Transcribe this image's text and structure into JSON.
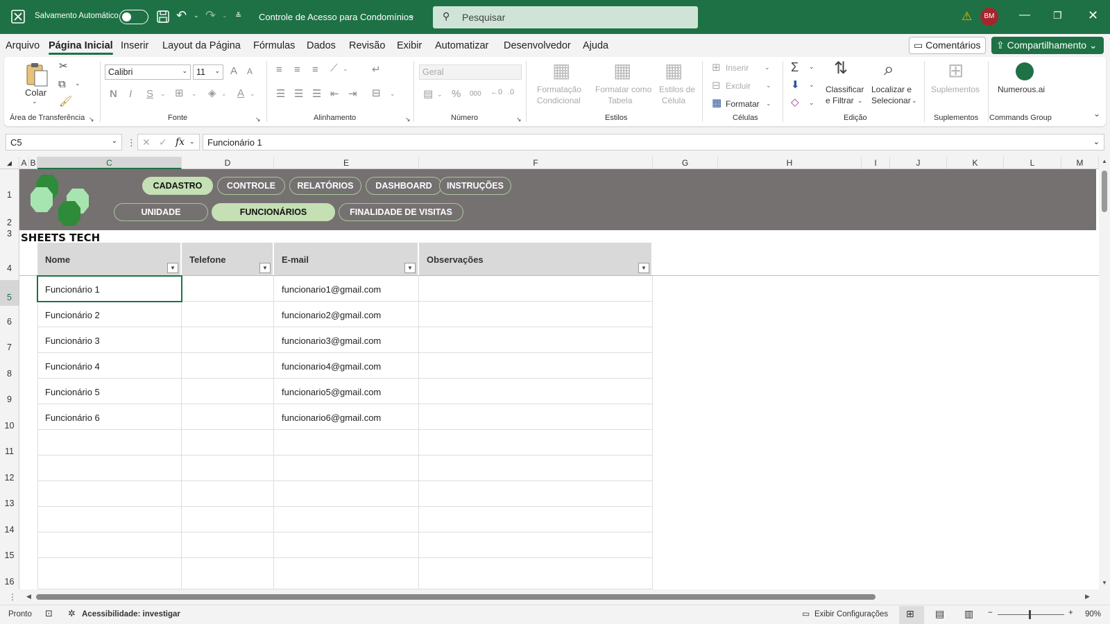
{
  "titlebar": {
    "autosave_label": "Salvamento Automático",
    "doc_title": "Controle de Acesso para Condomínios",
    "search_placeholder": "Pesquisar",
    "avatar_initials": "BM"
  },
  "menu": {
    "tabs": [
      "Arquivo",
      "Página Inicial",
      "Inserir",
      "Layout da Página",
      "Fórmulas",
      "Dados",
      "Revisão",
      "Exibir",
      "Automatizar",
      "Desenvolvedor",
      "Ajuda"
    ],
    "active_index": 1,
    "comments_label": "Comentários",
    "share_label": "Compartilhamento"
  },
  "ribbon": {
    "clipboard": {
      "paste_label": "Colar",
      "group": "Área de Transferência"
    },
    "font": {
      "name": "Calibri",
      "size": "11",
      "group": "Fonte",
      "bold": "N",
      "italic": "I",
      "underline": "S",
      "grow": "A",
      "shrink": "A",
      "color": "A"
    },
    "alignment": {
      "group": "Alinhamento"
    },
    "number": {
      "format": "Geral",
      "percent": "%",
      "thousands": "000",
      "group": "Número"
    },
    "styles": {
      "cond1": "Formatação",
      "cond2": "Condicional",
      "table1": "Formatar como",
      "table2": "Tabela",
      "cell1": "Estilos de",
      "cell2": "Célula",
      "group": "Estilos"
    },
    "cells": {
      "insert": "Inserir",
      "delete": "Excluir",
      "format": "Formatar",
      "group": "Células"
    },
    "editing": {
      "sort1": "Classificar",
      "sort2": "e Filtrar",
      "find1": "Localizar e",
      "find2": "Selecionar",
      "group": "Edição"
    },
    "addins": {
      "label": "Suplementos",
      "group": "Suplementos"
    },
    "commands": {
      "label": "Numerous.ai",
      "group": "Commands Group"
    }
  },
  "formula_bar": {
    "name_box": "C5",
    "content": "Funcionário 1",
    "fx": "fx"
  },
  "columns": [
    "A",
    "B",
    "C",
    "D",
    "E",
    "F",
    "G",
    "H",
    "I",
    "J",
    "K",
    "L",
    "M"
  ],
  "rows": [
    "1",
    "2",
    "3",
    "4",
    "5",
    "6",
    "7",
    "8",
    "9",
    "10",
    "11",
    "12",
    "13",
    "14",
    "15",
    "16"
  ],
  "nav_top": [
    "CADASTRO",
    "CONTROLE",
    "RELATÓRIOS",
    "DASHBOARD",
    "INSTRUÇÕES"
  ],
  "nav_sub": [
    "UNIDADE",
    "FUNCIONÁRIOS",
    "FINALIDADE DE VISITAS"
  ],
  "brand": "SHEETS TECH",
  "table": {
    "headers": [
      "Nome",
      "Telefone",
      "E-mail",
      "Observações"
    ],
    "rows": [
      [
        "Funcionário 1",
        "",
        "funcionario1@gmail.com",
        ""
      ],
      [
        "Funcionário 2",
        "",
        "funcionario2@gmail.com",
        ""
      ],
      [
        "Funcionário 3",
        "",
        "funcionario3@gmail.com",
        ""
      ],
      [
        "Funcionário 4",
        "",
        "funcionario4@gmail.com",
        ""
      ],
      [
        "Funcionário 5",
        "",
        "funcionario5@gmail.com",
        ""
      ],
      [
        "Funcionário 6",
        "",
        "funcionario6@gmail.com",
        ""
      ]
    ]
  },
  "status": {
    "ready": "Pronto",
    "accessibility": "Acessibilidade: investigar",
    "display_settings": "Exibir Configurações",
    "zoom": "90%"
  },
  "colors": {
    "accent": "#1e7145",
    "banner": "#767171",
    "pill_active": "#c5e0b4"
  }
}
